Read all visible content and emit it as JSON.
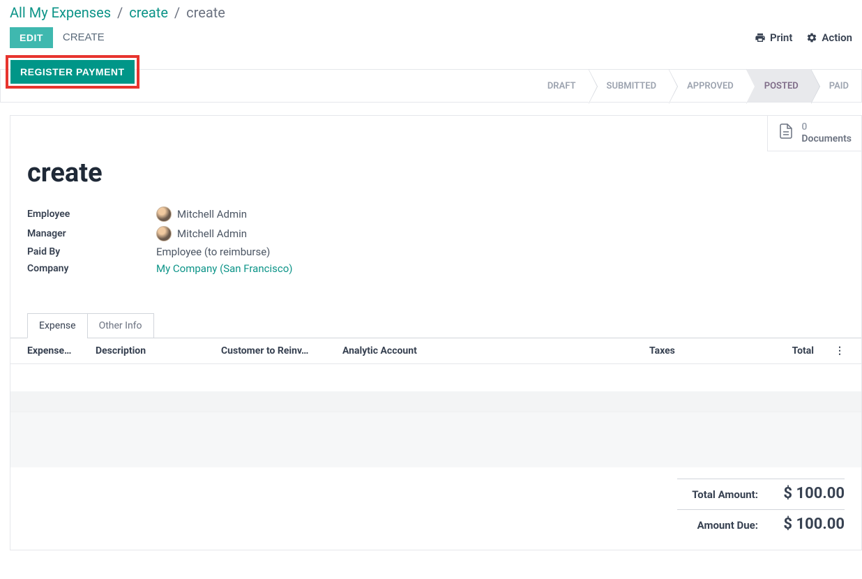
{
  "breadcrumb": {
    "root": "All My Expenses",
    "mid": "create",
    "current": "create"
  },
  "header": {
    "edit": "EDIT",
    "create": "CREATE",
    "print": "Print",
    "action": "Action"
  },
  "register": "REGISTER PAYMENT",
  "status": {
    "draft": "DRAFT",
    "submitted": "SUBMITTED",
    "approved": "APPROVED",
    "posted": "POSTED",
    "paid": "PAID"
  },
  "docs": {
    "count": "0",
    "label": "Documents"
  },
  "title": "create",
  "fields": {
    "employee_label": "Employee",
    "employee_value": "Mitchell Admin",
    "manager_label": "Manager",
    "manager_value": "Mitchell Admin",
    "paidby_label": "Paid By",
    "paidby_value": "Employee (to reimburse)",
    "company_label": "Company",
    "company_value": "My Company (San Francisco)"
  },
  "tabs": {
    "expense": "Expense",
    "other": "Other Info"
  },
  "columns": {
    "date": "Expense…",
    "desc": "Description",
    "customer": "Customer to Reinv…",
    "analytic": "Analytic Account",
    "taxes": "Taxes",
    "total": "Total"
  },
  "totals": {
    "total_label": "Total Amount:",
    "total_value": "$ 100.00",
    "due_label": "Amount Due:",
    "due_value": "$ 100.00"
  }
}
